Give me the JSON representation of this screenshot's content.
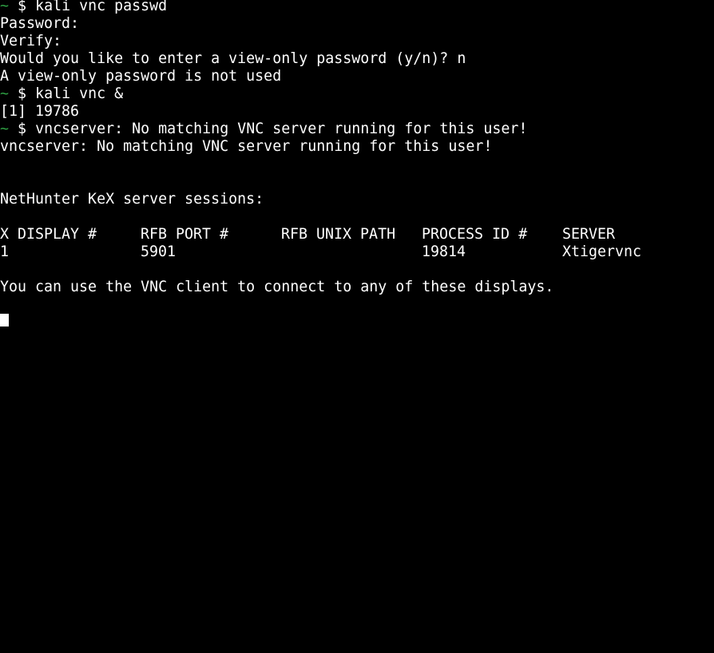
{
  "prompt_symbol": "~",
  "prompt_dollar": "$",
  "lines": {
    "l0_cmd": "kali vnc passwd",
    "l1": "Password:",
    "l2": "Verify:",
    "l3": "Would you like to enter a view-only password (y/n)? n",
    "l4": "A view-only password is not used",
    "l5_cmd": "kali vnc &",
    "l6": "[1] 19786",
    "l7_cmd": "vncserver: No matching VNC server running for this user!",
    "l8": "vncserver: No matching VNC server running for this user!",
    "l11": "NetHunter KeX server sessions:",
    "l16": "You can use the VNC client to connect to any of these displays."
  },
  "table": {
    "headers": [
      "X DISPLAY #",
      "RFB PORT #",
      "RFB UNIX PATH",
      "PROCESS ID #",
      "SERVER"
    ],
    "rows": [
      [
        "1",
        "5901",
        "",
        "19814",
        "Xtigervnc"
      ]
    ]
  },
  "colors": {
    "background": "#000000",
    "foreground": "#ffffff",
    "prompt": "#2ea043"
  }
}
